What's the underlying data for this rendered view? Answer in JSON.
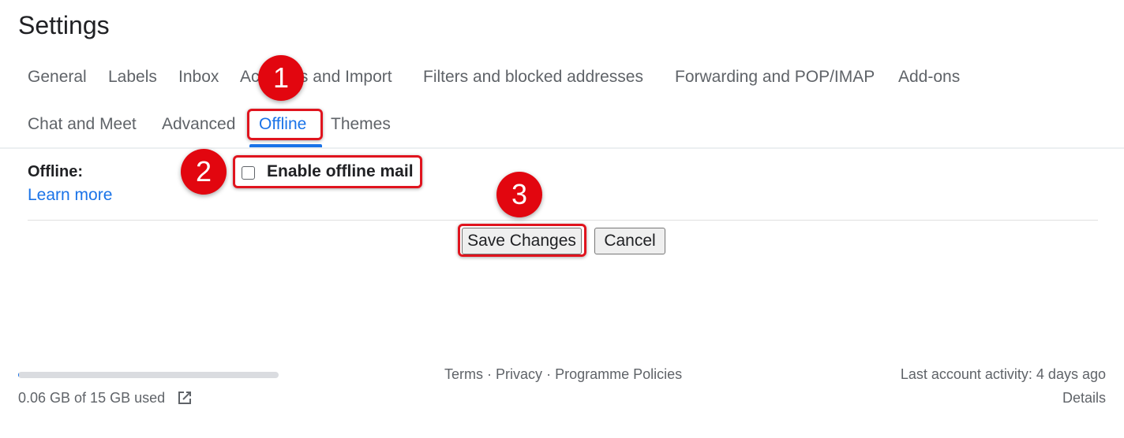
{
  "header": {
    "title": "Settings"
  },
  "tabs": [
    {
      "label": "General",
      "active": false
    },
    {
      "label": "Labels",
      "active": false
    },
    {
      "label": "Inbox",
      "active": false
    },
    {
      "label": "Accounts and Import",
      "active": false
    },
    {
      "label": "Filters and blocked addresses",
      "active": false
    },
    {
      "label": "Forwarding and POP/IMAP",
      "active": false
    },
    {
      "label": "Add-ons",
      "active": false
    },
    {
      "label": "Chat and Meet",
      "active": false
    },
    {
      "label": "Advanced",
      "active": false
    },
    {
      "label": "Offline",
      "active": true
    },
    {
      "label": "Themes",
      "active": false
    }
  ],
  "offline_section": {
    "label": "Offline:",
    "learn_more": "Learn more",
    "enable_checkbox_label": "Enable offline mail",
    "enable_checked": false
  },
  "actions": {
    "save_label": "Save Changes",
    "cancel_label": "Cancel"
  },
  "annotations": {
    "step1": "1",
    "step2": "2",
    "step3": "3",
    "color": "#e2060f"
  },
  "footer": {
    "storage_text": "0.06 GB of 15 GB used",
    "storage_used_fraction": 0.004,
    "terms": "Terms",
    "separator": "·",
    "privacy": "Privacy",
    "policies": "Programme Policies",
    "last_activity": "Last account activity: 4 days ago",
    "details": "Details"
  },
  "colors": {
    "accent": "#1a73e8",
    "text": "#202124",
    "muted": "#5f6368"
  }
}
